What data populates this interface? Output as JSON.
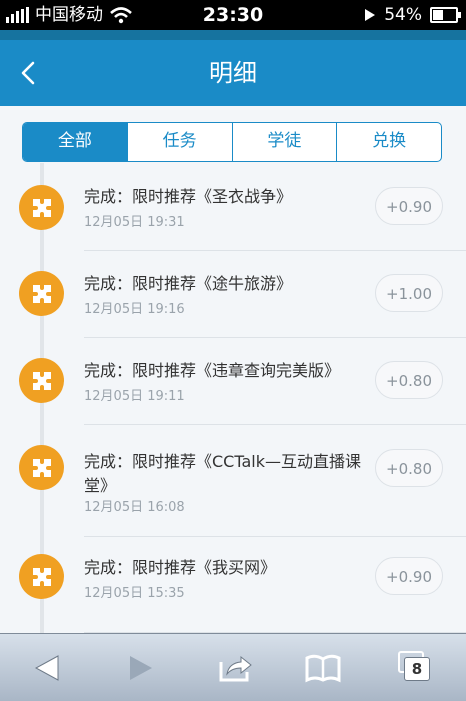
{
  "status_bar": {
    "carrier": "中国移动",
    "time": "23:30",
    "battery_percent": "54%",
    "battery_level": 0.54
  },
  "nav": {
    "title": "明细"
  },
  "tabs": [
    {
      "label": "全部",
      "active": true
    },
    {
      "label": "任务",
      "active": false
    },
    {
      "label": "学徒",
      "active": false
    },
    {
      "label": "兑换",
      "active": false
    }
  ],
  "records": [
    {
      "title": "完成：限时推荐《圣衣战争》",
      "date": "12月05日 19:31",
      "amount": "+0.90"
    },
    {
      "title": "完成：限时推荐《途牛旅游》",
      "date": "12月05日 19:16",
      "amount": "+1.00"
    },
    {
      "title": "完成：限时推荐《违章查询完美版》",
      "date": "12月05日 19:11",
      "amount": "+0.80"
    },
    {
      "title": "完成：限时推荐《CCTalk—互动直播课堂》",
      "date": "12月05日 16:08",
      "amount": "+0.80"
    },
    {
      "title": "完成：限时推荐《我买网》",
      "date": "12月05日 15:35",
      "amount": "+0.90"
    }
  ],
  "browser_toolbar": {
    "tab_count": "8"
  },
  "colors": {
    "primary": "#1a8bc7",
    "badge": "#f0a022"
  }
}
